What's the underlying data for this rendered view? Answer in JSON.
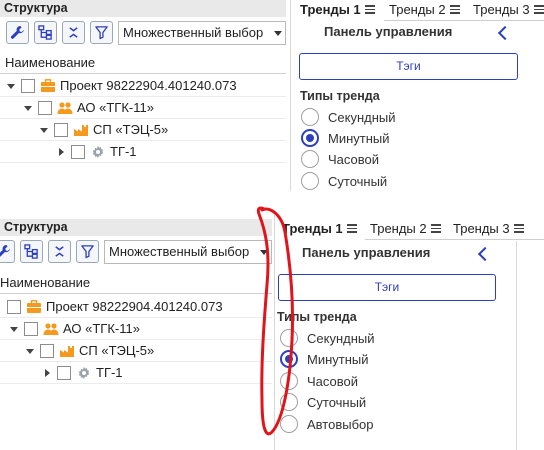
{
  "top": {
    "structure_title": "Структура",
    "select_value": "Множественный выбор",
    "column_header": "Наименование",
    "tree": [
      {
        "label": "Проект 98222904.401240.073",
        "icon": "briefcase-icon",
        "expander": "down"
      },
      {
        "label": "АО «ТГК-11»",
        "icon": "organization-icon",
        "expander": "down"
      },
      {
        "label": "СП «ТЭЦ-5»",
        "icon": "factory-icon",
        "expander": "down"
      },
      {
        "label": "ТГ-1",
        "icon": "gear-icon",
        "expander": "right"
      }
    ],
    "tabs": [
      "Тренды 1",
      "Тренды 2",
      "Тренды 3"
    ],
    "control_panel_title": "Панель управления",
    "tags_button": "Тэги",
    "trend_types_title": "Типы тренда",
    "trend_types": [
      "Секундный",
      "Минутный",
      "Часовой",
      "Суточный"
    ],
    "selected_trend_type": "Минутный"
  },
  "bottom": {
    "structure_title": "Структура",
    "select_value": "Множественный выбор",
    "column_header": "Наименование",
    "tree": [
      {
        "label": "Проект 98222904.401240.073",
        "icon": "briefcase-icon",
        "expander": "none"
      },
      {
        "label": "АО «ТГК-11»",
        "icon": "organization-icon",
        "expander": "down"
      },
      {
        "label": "СП «ТЭЦ-5»",
        "icon": "factory-icon",
        "expander": "down"
      },
      {
        "label": "ТГ-1",
        "icon": "gear-icon",
        "expander": "right"
      }
    ],
    "tabs": [
      "Тренды 1",
      "Тренды 2",
      "Тренды 3"
    ],
    "control_panel_title": "Панель управления",
    "tags_button": "Тэги",
    "trend_types_title": "Типы тренда",
    "trend_types": [
      "Секундный",
      "Минутный",
      "Часовой",
      "Суточный",
      "Автовыбор"
    ],
    "selected_trend_type": "Минутный"
  },
  "colors": {
    "accent": "#2c3fc0",
    "icon_orange": "#f39a1e",
    "annotation": "#e0151b",
    "header_bg": "#e9e9e9"
  }
}
